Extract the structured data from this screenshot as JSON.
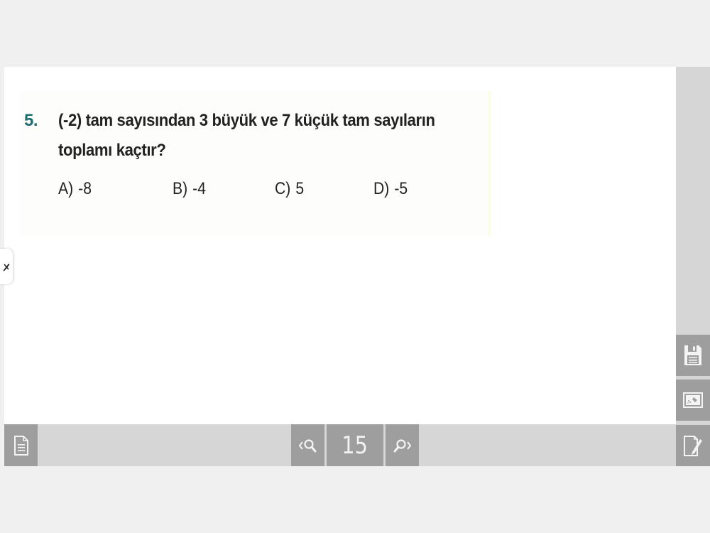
{
  "question": {
    "number": "5.",
    "line1": "(-2) tam sayısından 3 büyük ve 7 küçük tam sayıların",
    "line2": "toplamı kaçtır?",
    "choices": [
      {
        "label": "A)",
        "value": "-8"
      },
      {
        "label": "B)",
        "value": "-4"
      },
      {
        "label": "C)",
        "value": "5"
      },
      {
        "label": "D)",
        "value": "-5"
      }
    ]
  },
  "toolbar": {
    "page_number": "15"
  },
  "icons": {
    "pen_tab": "pen-tool-icon",
    "save": "floppy-disk-icon",
    "image": "image-icon",
    "note": "edit-note-icon",
    "pages": "document-icon",
    "zoom_out": "zoom-out-icon",
    "zoom_in": "zoom-in-icon"
  },
  "colors": {
    "question_number": "#1e6d73",
    "button_bg": "#9e9e9e",
    "bar_bg": "#d6d6d6"
  }
}
